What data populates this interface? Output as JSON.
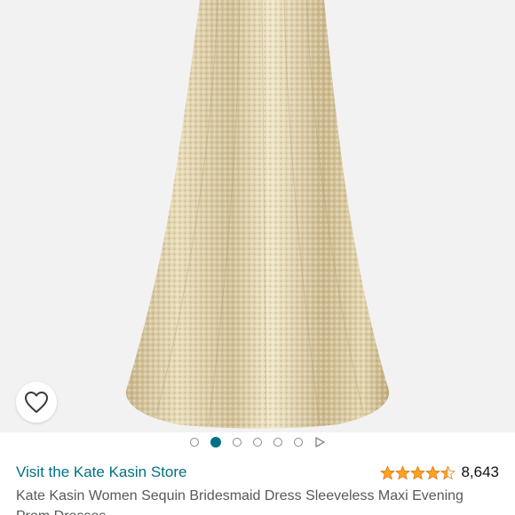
{
  "product": {
    "store_link": "Visit the Kate Kasin Store",
    "rating_value": 4.5,
    "rating_max": 5,
    "rating_count": "8,643",
    "title": "Kate Kasin Women Sequin Bridesmaid Dress Sleeveless Maxi Evening Prom Dresses"
  },
  "carousel": {
    "total_images": 6,
    "active_index": 1,
    "has_video": true
  },
  "icons": {
    "wishlist": "heart-outline-icon",
    "video": "play-icon",
    "star": "star-icon"
  },
  "colors": {
    "link": "#007185",
    "star": "#ffa41c",
    "text_secondary": "#565959",
    "image_bg": "#f2f2f2",
    "dress_gold": "#d9c79a"
  }
}
